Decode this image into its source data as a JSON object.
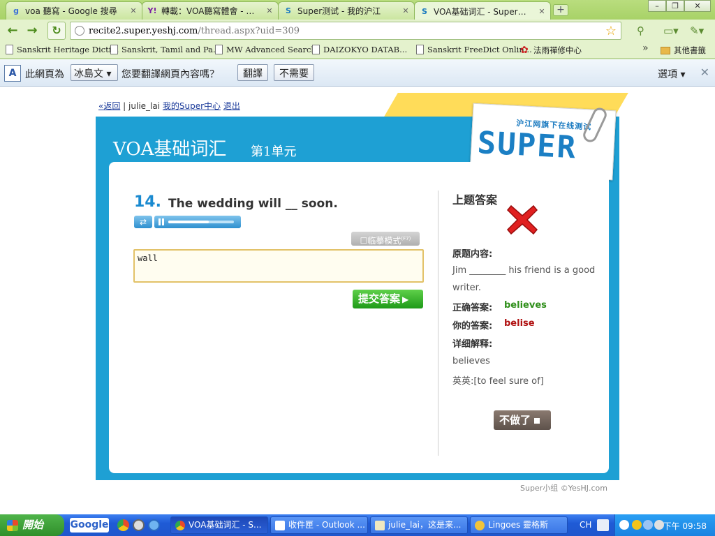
{
  "browser": {
    "tabs": [
      {
        "label": "voa 聽寫 - Google 搜尋",
        "favicon": "google-icon"
      },
      {
        "label": "轉載：VOA聽寫體會 - 藍...",
        "favicon": "yahoo-icon"
      },
      {
        "label": "Super测试 - 我的沪江",
        "favicon": "super-icon"
      },
      {
        "label": "VOA基础词汇 - Super在线...",
        "favicon": "super-icon",
        "active": true
      }
    ],
    "url_host": "recite2.super.yeshj.com",
    "url_path": "/thread.aspx?uid=309",
    "bookmarks": [
      "Sanskrit Heritage Dicti...",
      "Sanskrit, Tamil and Pa...",
      "MW Advanced Search",
      "DAIZOKYO DATAB...",
      "Sanskrit FreeDict Onlin...",
      "法雨禪修中心"
    ],
    "bookmarks_overflow": "»",
    "other_bookmarks": "其他書籤",
    "translate": {
      "prefix": "此網頁為",
      "language": "冰島文",
      "question": "您要翻譯網頁內容嗎？",
      "translate_btn": "翻譯",
      "no_btn": "不需要",
      "options": "選項 ▾"
    }
  },
  "page": {
    "nav": {
      "back": "«返回",
      "separator": "|",
      "user": "julie_lai",
      "my_center": "我的Super中心",
      "logout": "退出"
    },
    "title": "VOA基础词汇",
    "unit": "第1单元",
    "logo_slogan": "沪江网旗下在线测试",
    "logo_word": "SUPER",
    "question": {
      "number": "14.",
      "text": "The wedding will __ soon.",
      "audio_progress": 0.62,
      "copy_mode_label": "☐临摹模式",
      "copy_mode_key": "(F7)",
      "answer_value": "wall",
      "submit_label": "提交答案"
    },
    "previous": {
      "title": "上题答案",
      "original_label": "原题内容:",
      "original_text": "Jim ________ his friend is a good writer.",
      "correct_label": "正确答案:",
      "correct_value": "believes",
      "yours_label": "你的答案:",
      "yours_value": "belise",
      "explain_label": "详细解释:",
      "explain_word": "believes",
      "explain_def": "英英:[to feel sure of]"
    },
    "quit_label": "不做了",
    "footer": "Super小组 ©YesHJ.com"
  },
  "taskbar": {
    "start": "開始",
    "google": "Google",
    "tasks": [
      {
        "label": "VOA基础词汇 - S...",
        "active": true
      },
      {
        "label": "收件匣 - Outlook ..."
      },
      {
        "label": "julie_lai，这是来..."
      },
      {
        "label": "Lingoes 靈格斯"
      }
    ],
    "ime": "CH",
    "clock": "下午 09:58"
  },
  "colors": {
    "frame_blue": "#1ea0d4",
    "correct_green": "#2f8f1a",
    "wrong_red": "#b01010",
    "submit_green": "#1e9a18"
  }
}
